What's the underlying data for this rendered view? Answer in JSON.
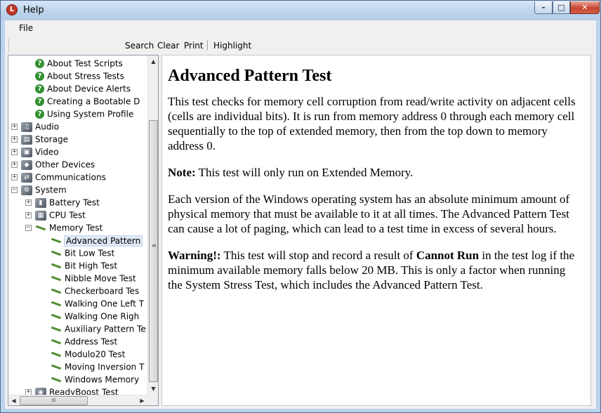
{
  "window": {
    "title": "Help",
    "app_icon_letter": "L",
    "min_glyph": "–",
    "max_glyph": "□",
    "close_glyph": "✕"
  },
  "menu": {
    "file": "File"
  },
  "toolbar": {
    "search": "Search",
    "clear": "Clear",
    "print": "Print",
    "highlight": "Highlight"
  },
  "tree": {
    "rows": [
      {
        "label": "About Test Scripts",
        "icon": "question-icon",
        "level": "child",
        "expander": ""
      },
      {
        "label": "About Stress Tests",
        "icon": "question-icon",
        "level": "child",
        "expander": ""
      },
      {
        "label": "About Device Alerts",
        "icon": "question-icon",
        "level": "child",
        "expander": ""
      },
      {
        "label": "Creating a Bootable D",
        "icon": "question-icon",
        "level": "child",
        "expander": ""
      },
      {
        "label": "Using System Profile",
        "icon": "question-icon",
        "level": "child",
        "expander": ""
      },
      {
        "label": "Audio",
        "icon": "speaker-icon",
        "level": "top",
        "expander": "+"
      },
      {
        "label": "Storage",
        "icon": "disk-icon",
        "level": "top",
        "expander": "+"
      },
      {
        "label": "Video",
        "icon": "monitor-icon",
        "level": "top",
        "expander": "+"
      },
      {
        "label": "Other Devices",
        "icon": "devices-icon",
        "level": "top",
        "expander": "+"
      },
      {
        "label": "Communications",
        "icon": "network-icon",
        "level": "top",
        "expander": "+"
      },
      {
        "label": "System",
        "icon": "system-icon",
        "level": "top",
        "expander": "−"
      },
      {
        "label": "Battery Test",
        "icon": "battery-icon",
        "level": "sub",
        "expander": "+"
      },
      {
        "label": "CPU Test",
        "icon": "cpu-icon",
        "level": "sub",
        "expander": "+"
      },
      {
        "label": "Memory Test",
        "icon": "memory-icon",
        "level": "sub",
        "expander": "−"
      },
      {
        "label": "Advanced Pattern",
        "icon": "memory-icon",
        "level": "leaf",
        "expander": "",
        "selected": true
      },
      {
        "label": "Bit Low Test",
        "icon": "memory-icon",
        "level": "leaf",
        "expander": ""
      },
      {
        "label": "Bit High Test",
        "icon": "memory-icon",
        "level": "leaf",
        "expander": ""
      },
      {
        "label": "Nibble Move Test",
        "icon": "memory-icon",
        "level": "leaf",
        "expander": ""
      },
      {
        "label": "Checkerboard Tes",
        "icon": "memory-icon",
        "level": "leaf",
        "expander": ""
      },
      {
        "label": "Walking One Left T",
        "icon": "memory-icon",
        "level": "leaf",
        "expander": ""
      },
      {
        "label": "Walking One Righ",
        "icon": "memory-icon",
        "level": "leaf",
        "expander": ""
      },
      {
        "label": "Auxiliary Pattern Te",
        "icon": "memory-icon",
        "level": "leaf",
        "expander": ""
      },
      {
        "label": "Address Test",
        "icon": "memory-icon",
        "level": "leaf",
        "expander": ""
      },
      {
        "label": "Modulo20 Test",
        "icon": "memory-icon",
        "level": "leaf",
        "expander": ""
      },
      {
        "label": "Moving Inversion T",
        "icon": "memory-icon",
        "level": "leaf",
        "expander": ""
      },
      {
        "label": "Windows Memory",
        "icon": "memory-icon",
        "level": "leaf",
        "expander": ""
      },
      {
        "label": "ReadyBoost Test",
        "icon": "readyboost-icon",
        "level": "sub",
        "expander": "+"
      }
    ],
    "scroll_up": "▲",
    "scroll_down": "▼",
    "scroll_left": "◀",
    "scroll_right": "▶",
    "vgrip": "≡",
    "hgrip": "III"
  },
  "article": {
    "heading": "Advanced Pattern Test",
    "p1": "This test checks for memory cell corruption from read/write activity on adjacent cells (cells are individual bits). It is run from memory address 0 through each memory cell sequentially to the top of extended memory, then from the top down to memory address 0.",
    "note_label": "Note:",
    "note_text": " This test will only run on Extended Memory.",
    "p3": "Each version of the Windows operating system has an absolute minimum amount of physical memory that must be available to it at all times. The Advanced Pattern Test can cause a lot of paging, which can lead to a test time in excess of several hours.",
    "warning_label": "Warning!:",
    "warning_text_1": " This test will stop and record a result of ",
    "warning_bold": "Cannot Run",
    "warning_text_2": " in the test log if the minimum available memory falls below 20 MB. This is only a factor when running the System Stress Test, which includes the Advanced Pattern Test."
  },
  "colors": {
    "frame": "#bcd3ec",
    "close_button": "#c7452f",
    "help_icon": "#2f8f2f"
  }
}
